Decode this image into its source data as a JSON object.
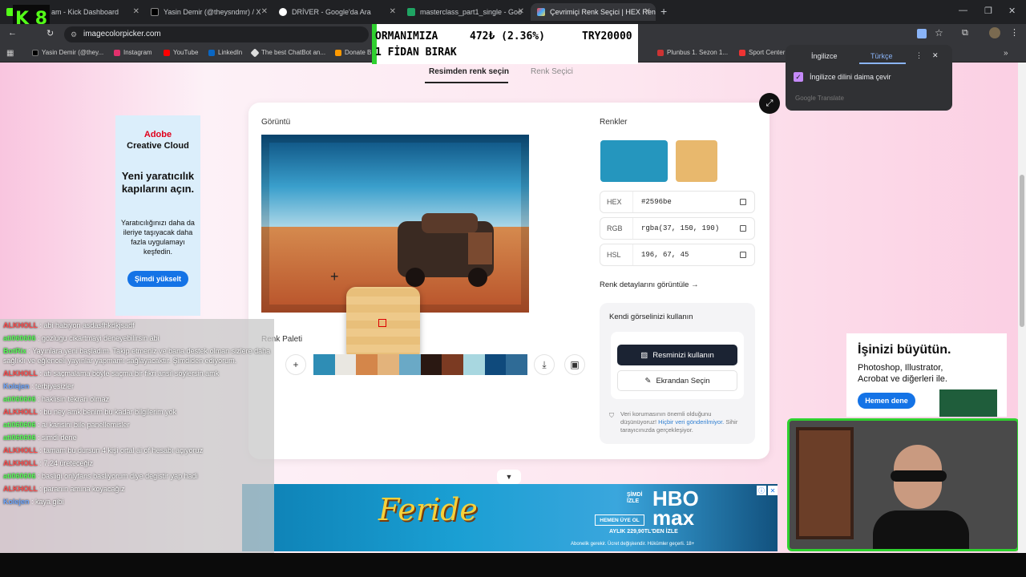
{
  "browser": {
    "tabs": [
      {
        "label": "am - Kick Dashboard",
        "active": false
      },
      {
        "label": "Yasin Demir (@theysndmr) / X",
        "active": false
      },
      {
        "label": "DRİVER - Google'da Ara",
        "active": false
      },
      {
        "label": "masterclass_part1_single - Goo",
        "active": false
      },
      {
        "label": "Çevrimiçi Renk Seçici | HEX Ren",
        "active": true
      }
    ],
    "new_tab": "+",
    "url": "imagecolorpicker.com",
    "bookmarks": [
      "Yasin Demir (@they...",
      "Instagram",
      "YouTube",
      "LinkedIn",
      "The best ChatBot an...",
      "Donate B",
      "Plunbus 1. Sezon 1...",
      "Sport Center"
    ],
    "bookmarks_more": "»"
  },
  "overlay_logo": "K 8",
  "ticker": {
    "line1_left": "ORMANIMIZA",
    "line1_mid": "472₺ (2.36%)",
    "line1_right": "TRY20000",
    "line2": "1 FİDAN BIRAK"
  },
  "translate_popup": {
    "tab_source": "İngilizce",
    "tab_target": "Türkçe",
    "checkbox_label": "İngilizce dilini daima çevir",
    "footer": "Google Translate"
  },
  "page": {
    "tab_from_image": "Resimden renk seçin",
    "tab_picker": "Renk Seçici",
    "image_label": "Görüntü",
    "colors_label": "Renkler",
    "swatch_primary": "#2596be",
    "swatch_secondary": "#e8b86d",
    "hex_key": "HEX",
    "hex_value": "#2596be",
    "rgb_key": "RGB",
    "rgb_value": "rgba(37, 150, 190)",
    "hsl_key": "HSL",
    "hsl_value": "196, 67, 45",
    "details_link": "Renk detaylarını görüntüle →",
    "palette_label": "Renk Paleti",
    "palette": [
      "#2e8db5",
      "#e9e7e1",
      "#d4864a",
      "#e3b37b",
      "#6aa9c6",
      "#2a1812",
      "#7b3a22",
      "#a8d7e0",
      "#0f4a7c",
      "#2f6b96"
    ],
    "upload_title": "Kendi görselinizi kullanın",
    "upload_button": "Resminizi kullanın",
    "screen_button": "Ekrandan Seçin",
    "privacy_text": "Veri korumasının önemli olduğunu düşünüyoruz!",
    "privacy_link": "Hiçbir veri gönderilmiyor.",
    "privacy_text2": "Sihir tarayıcınızda gerçekleşiyor."
  },
  "ads": {
    "left_brand": "Adobe",
    "left_product": "Creative Cloud",
    "left_headline": "Yeni yaratıcılık kapılarını açın.",
    "left_body": "Yaratıcılığınızı daha da ileriye taşıyacak daha fazla uygulamayı keşfedin.",
    "left_cta": "Şimdi yükselt",
    "right_headline": "İşinizi büyütün.",
    "right_body": "Photoshop, Illustrator, Acrobat ve diğerleri ile.",
    "right_cta": "Hemen dene",
    "bottom_title": "Feride",
    "bottom_now": "ŞİMDİ İZLE",
    "bottom_brand": "HBO max",
    "bottom_cta": "HEMEN ÜYE OL",
    "bottom_price": "AYLIK 229,90TL'DEN İZLE",
    "bottom_fine": "Abonelik gerekir. Ücret değişkendir. Hükümler geçerli. 18+"
  },
  "chat": [
    {
      "user": "ALKHOLL",
      "text": "abi habiyon asdasfhkdkjsadf",
      "color": "#ff4d4d"
    },
    {
      "user": "ati060606",
      "text": "gozlugu cikartmayi deneyebilirsin abi",
      "color": "#55ff55"
    },
    {
      "user": "BotRix",
      "text": "Yayınlara yeni başladım. Takip etmeniz ve bana destek olman sizlere daha sağlıklı ve eğlenceli yayınlar yapmamı sağlayacaktır. Şimdiden ediyorum.",
      "color": "#55ff55"
    },
    {
      "user": "ALKHOLL",
      "text": "ati saçmalama böyle saçma bir fikri ansil söylersin amk",
      "color": "#ff4d4d"
    },
    {
      "user": "Kolejen",
      "text": "terbiyesizler",
      "color": "#6ea7ff"
    },
    {
      "user": "ati060606",
      "text": "haklisin tekrari olmaz",
      "color": "#55ff55"
    },
    {
      "user": "ALKHOLL",
      "text": "bu ney amk benim bu kadar bilgilerim yok",
      "color": "#ff4d4d"
    },
    {
      "user": "ati060606",
      "text": "ai karisini bile panellemisler",
      "color": "#55ff55"
    },
    {
      "user": "ati060606",
      "text": "simdi dene",
      "color": "#55ff55"
    },
    {
      "user": "ALKHOLL",
      "text": "tamam bu dursun 4 kişi ortal ai of hesabı açıyoruz",
      "color": "#ff4d4d"
    },
    {
      "user": "ALKHOLL",
      "text": "7.24 üreteceğiz",
      "color": "#ff4d4d"
    },
    {
      "user": "ati060606",
      "text": "basligi onlyfans basliyorum diye degistir yap hadi",
      "color": "#55ff55"
    },
    {
      "user": "ALKHOLL",
      "text": "paranın amına koyacağız",
      "color": "#ff4d4d"
    },
    {
      "user": "Kolejen",
      "text": "kaya gibi",
      "color": "#6ea7ff"
    }
  ]
}
